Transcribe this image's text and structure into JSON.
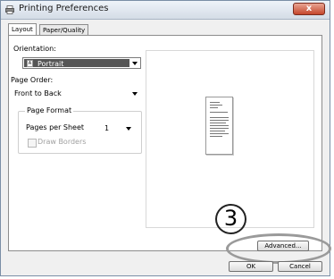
{
  "window": {
    "title": "Printing Preferences",
    "close_label": "x"
  },
  "tabs": [
    {
      "label": "Layout"
    },
    {
      "label": "Paper/Quality"
    }
  ],
  "layout": {
    "orientation_label": "Orientation:",
    "orientation_value": "Portrait",
    "page_order_label": "Page Order:",
    "page_order_value": "Front to Back",
    "page_format_title": "Page Format",
    "pages_per_sheet_label": "Pages per Sheet",
    "pages_per_sheet_value": "1",
    "draw_borders_label": "Draw Borders",
    "callout_number": "3",
    "advanced_label": "Advanced..."
  },
  "footer": {
    "ok_label": "OK",
    "cancel_label": "Cancel"
  }
}
